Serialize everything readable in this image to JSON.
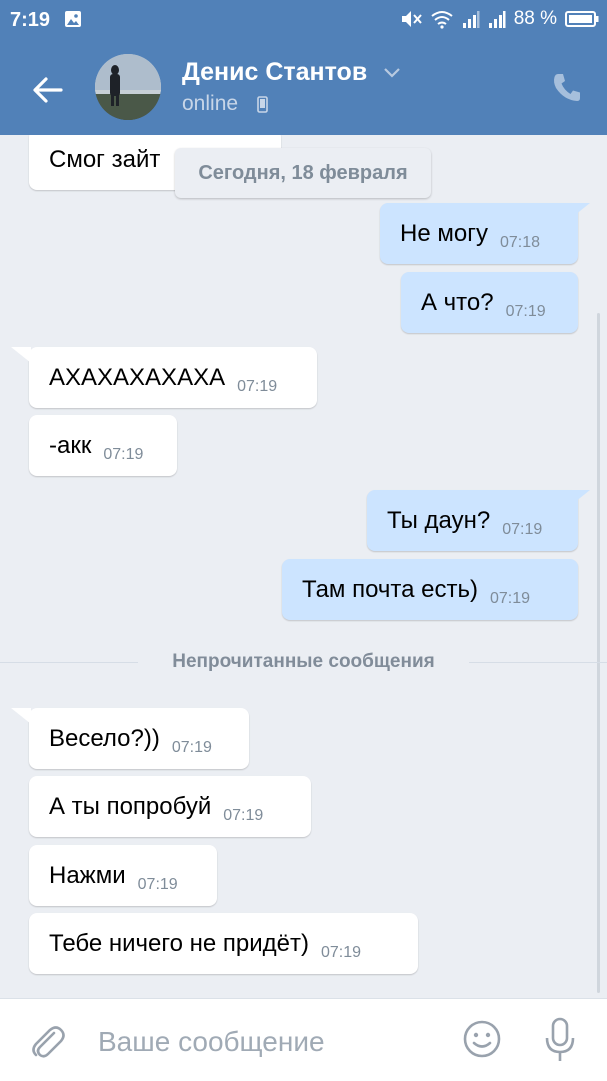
{
  "status_bar": {
    "time": "7:19",
    "battery": "88 %"
  },
  "header": {
    "contact_name": "Денис Стантов",
    "status": "online"
  },
  "chat": {
    "date_chip": "Сегодня, 18 февраля",
    "unread_separator": "Непрочитанные сообщения",
    "messages": [
      {
        "text": "Смог зайт",
        "time": "",
        "dir": "in"
      },
      {
        "text": "Не могу",
        "time": "07:18",
        "dir": "out"
      },
      {
        "text": "А что?",
        "time": "07:19",
        "dir": "out"
      },
      {
        "text": "АХАХАХАХАХА",
        "time": "07:19",
        "dir": "in"
      },
      {
        "text": "-акк",
        "time": "07:19",
        "dir": "in"
      },
      {
        "text": "Ты даун?",
        "time": "07:19",
        "dir": "out"
      },
      {
        "text": "Там почта есть)",
        "time": "07:19",
        "dir": "out"
      },
      {
        "text": "Весело?))",
        "time": "07:19",
        "dir": "in"
      },
      {
        "text": "А ты попробуй",
        "time": "07:19",
        "dir": "in"
      },
      {
        "text": "Нажми",
        "time": "07:19",
        "dir": "in"
      },
      {
        "text": "Тебе ничего не придёт)",
        "time": "07:19",
        "dir": "in"
      }
    ]
  },
  "composer": {
    "placeholder": "Ваше сообщение"
  },
  "colors": {
    "header_bg": "#5181b8",
    "chat_bg": "#ebeef3",
    "outgoing_bubble": "#cce4ff",
    "incoming_bubble": "#ffffff",
    "timestamp": "#7f8c99"
  },
  "icons": [
    "back-arrow-icon",
    "chevron-down-icon",
    "mobile-phone-icon",
    "phone-call-icon",
    "paperclip-icon",
    "smile-icon",
    "microphone-icon",
    "image-icon",
    "mute-icon",
    "wifi-icon",
    "signal-icon",
    "battery-icon"
  ]
}
